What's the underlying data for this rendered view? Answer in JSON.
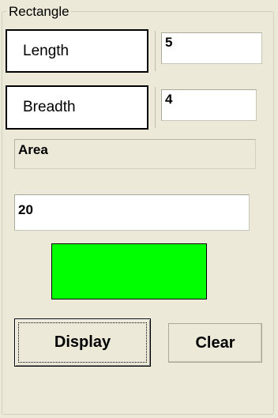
{
  "group": {
    "title": "Rectangle"
  },
  "length": {
    "label": "Length",
    "value": "5"
  },
  "breadth": {
    "label": "Breadth",
    "value": "4"
  },
  "area": {
    "label": "Area",
    "value": "20"
  },
  "color_panel": {
    "color": "#00ff00"
  },
  "buttons": {
    "display": "Display",
    "clear": "Clear"
  }
}
